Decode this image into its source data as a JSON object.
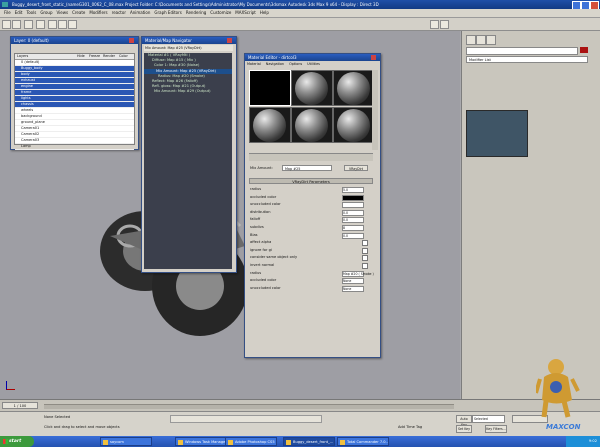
{
  "app": {
    "title": "Buggy_desert_front_static_(nameG301_0062_C_08.max    Project Folder: C:\\Documents and Settings\\Administrator\\My Documents\\3dsmax    Autodesk 3ds Max 9 x64    -    Display : Direct 3D"
  },
  "menu": [
    "File",
    "Edit",
    "Tools",
    "Group",
    "Views",
    "Create",
    "Modifiers",
    "reactor",
    "Animation",
    "Graph Editors",
    "Rendering",
    "Customize",
    "MAXScript",
    "Help"
  ],
  "layer_manager": {
    "title": "Layer: 0 (default)",
    "columns": [
      "Layers",
      "Hide",
      "Freeze",
      "Render",
      "Color"
    ],
    "rows": [
      "0 (default)",
      "Buggy_body",
      "body",
      "exhaust",
      "engine",
      "frame",
      "lights",
      "chassis",
      "wheels",
      "background",
      "ground_plane",
      "Camera01",
      "Camera02",
      "Camera03",
      "Lamp"
    ]
  },
  "slate": {
    "title": "Material/Map Navigator",
    "header": "Mix Amount: Map #25 (VRayDirt)",
    "nodes": [
      "Material #1 ( VRayMtl )",
      "Diffuse: Map #15 ( Mix )",
      "Color 1: Map #30 (Noise)",
      "Mix Amount: Map #25 (VRayDirt)",
      "Radius: Map #20 (Smoke)",
      "Reflect: Map #26 (Falloff)",
      "Refl. gloss: Map #21 (Output)",
      "Mix Amount: Map #29 (Output)"
    ]
  },
  "material_editor": {
    "title": "Material Editor - dirtcol3",
    "menu": [
      "Material",
      "Navigation",
      "Options",
      "Utilities"
    ],
    "map_label": "Mix Amount:",
    "map_name": "Map #25",
    "map_type": "VRayDirt",
    "rollout": "VRayDirt Parameters",
    "params": [
      {
        "label": "radius",
        "value": "5.0"
      },
      {
        "label": "occluded color",
        "value": ""
      },
      {
        "label": "unoccluded color",
        "value": ""
      },
      {
        "label": "distribution",
        "value": "0.0"
      },
      {
        "label": "falloff",
        "value": "0.0"
      },
      {
        "label": "subdivs",
        "value": "8"
      },
      {
        "label": "Bias",
        "value": "0.0"
      },
      {
        "label": "affect alpha",
        "value": ""
      },
      {
        "label": "ignore for gi",
        "value": ""
      },
      {
        "label": "consider same object only",
        "value": ""
      },
      {
        "label": "invert normal",
        "value": ""
      },
      {
        "label": "radius",
        "value": "Map #20 ( Smoke )"
      },
      {
        "label": "occluded color",
        "value": "None"
      },
      {
        "label": "unoccluded color",
        "value": "None"
      }
    ]
  },
  "cmd_panel": {
    "modifier_list": "Modifier List"
  },
  "timeline": {
    "frame": "1 / 100"
  },
  "status": {
    "selection": "None Selected",
    "prompt": "Click and drag to select and move objects",
    "add_time_tag": "Add Time Tag",
    "auto_key": "Auto Key",
    "set_key": "Set Key",
    "selected": "Selected",
    "key_filters": "Key Filters..."
  },
  "taskbar": {
    "start": "start",
    "items": [
      "saycom",
      "Windows Task Manager",
      "Adobe Photoshop CS5",
      "Buggy_desert_front_...",
      "Total Commander 7.0..."
    ],
    "clock": "9:02"
  },
  "watermark": "MAXCON",
  "colors": {
    "titlebar": "#1f4fa8",
    "viewport": "#9e9ea4",
    "slate_bg": "#3b3f4c",
    "taskbar": "#2452b0"
  }
}
